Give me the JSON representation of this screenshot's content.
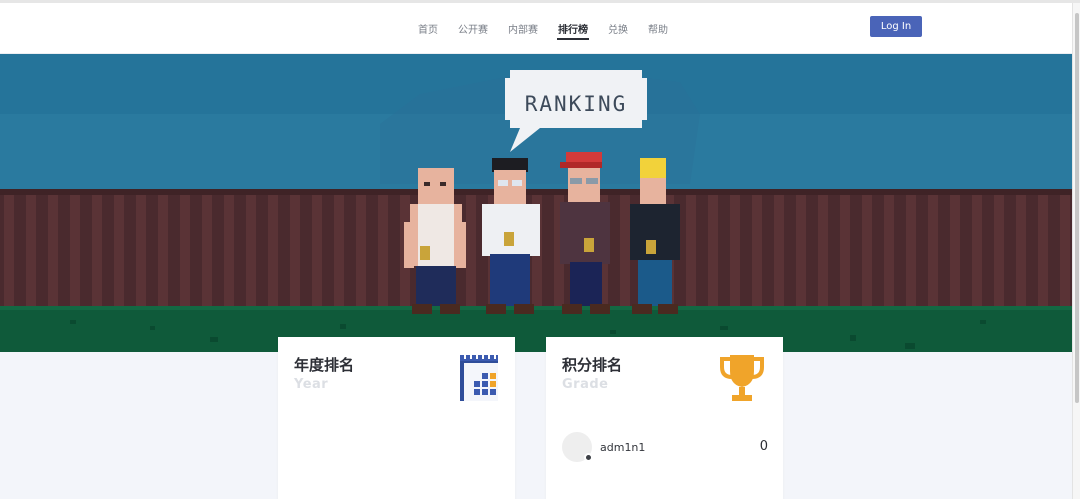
{
  "nav": {
    "items": [
      {
        "label": "首页",
        "active": false
      },
      {
        "label": "公开赛",
        "active": false
      },
      {
        "label": "内部赛",
        "active": false
      },
      {
        "label": "排行榜",
        "active": true
      },
      {
        "label": "兑换",
        "active": false
      },
      {
        "label": "帮助",
        "active": false
      }
    ],
    "login_label": "Log In"
  },
  "banner": {
    "speech_text": "RANKING",
    "colors": {
      "sky": "#2a7a9f",
      "fence": "#4a2a2e",
      "grass": "#0f5a3a"
    }
  },
  "cards": {
    "year": {
      "title": "年度排名",
      "subtitle": "Year",
      "icon": "calendar-icon"
    },
    "grade": {
      "title": "积分排名",
      "subtitle": "Grade",
      "icon": "trophy-icon",
      "entries": [
        {
          "name": "adm1n1",
          "score": "0"
        }
      ]
    }
  },
  "colors": {
    "accent": "#4a64b8",
    "page_bg": "#f3f5fa",
    "trophy": "#f0a42a"
  }
}
